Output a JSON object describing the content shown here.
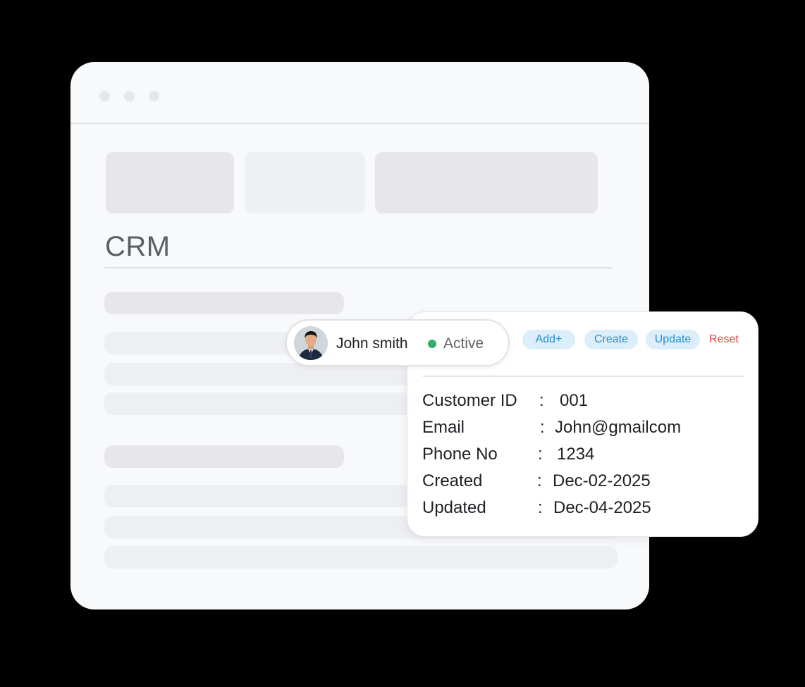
{
  "page": {
    "title": "CRM"
  },
  "user": {
    "name": "John smith",
    "status": "Active",
    "status_color": "#2fae6c"
  },
  "actions": {
    "add_label": "Add+",
    "create_label": "Create",
    "update_label": "Update",
    "reset_label": "Reset"
  },
  "details": {
    "separator": ":",
    "rows": [
      {
        "label": "Customer ID",
        "value": "001"
      },
      {
        "label": "Email",
        "value": "John@gmailcom"
      },
      {
        "label": "Phone No",
        "value": "1234"
      },
      {
        "label": "Created",
        "value": "Dec-02-2025"
      },
      {
        "label": "Updated",
        "value": "Dec-04-2025"
      }
    ]
  },
  "colors": {
    "accent": "#2a8fcf",
    "action_bg": "#dbeefa",
    "reset": "#e0474b"
  },
  "icons": {
    "avatar": "user-avatar-photo"
  }
}
